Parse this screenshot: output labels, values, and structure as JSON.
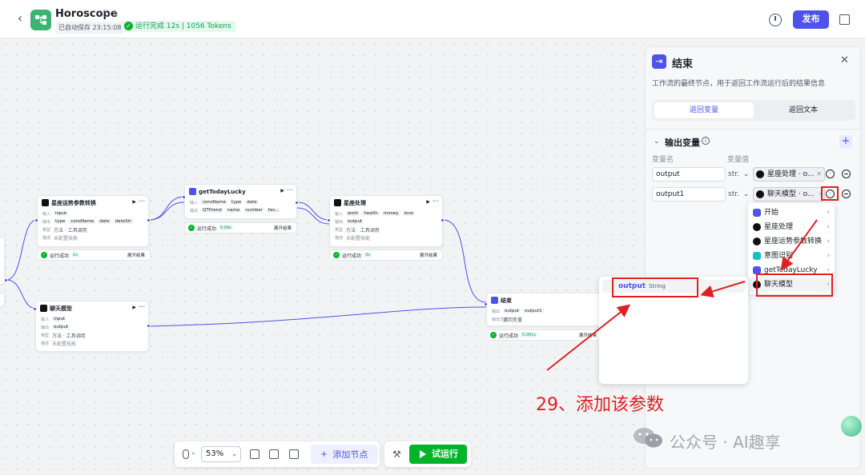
{
  "header": {
    "title": "Horoscope",
    "autosave": "已自动保存 23:15:08",
    "run_status": "运行完成 12s | 1056 Tokens",
    "publish": "发布"
  },
  "canvas": {
    "nodes": {
      "zodiac_convert": {
        "title": "星座运势参数转换",
        "input_label": "输入",
        "input": "input",
        "output_label": "输出",
        "outputs": [
          "type",
          "consName",
          "date",
          "dateStr"
        ],
        "type_label": "类型",
        "type_value": "方法 · 工具调用",
        "desc_label": "描述",
        "desc_value": "未配置技能",
        "status": "运行成功",
        "time": "1s",
        "expand": "展开结果"
      },
      "get_today_lucky": {
        "title": "getTodayLucky",
        "input_label": "输入",
        "inputs": [
          "consName",
          "type",
          "date"
        ],
        "output_label": "输出",
        "outputs": [
          "QTfriend",
          "name",
          "number",
          "fav..."
        ],
        "status": "运行成功",
        "time": "0.99s",
        "expand": "展开结果"
      },
      "zodiac_process": {
        "title": "星座处理",
        "input_label": "输入",
        "inputs": [
          "work",
          "health",
          "money",
          "love"
        ],
        "output_label": "输出",
        "outputs": [
          "output"
        ],
        "type_label": "类型",
        "type_value": "方法 · 工具调用",
        "desc_label": "描述",
        "desc_value": "未配置技能",
        "status": "运行成功",
        "time": "3s",
        "expand": "展开结果"
      },
      "chat_model": {
        "title": "聊天模型",
        "input_label": "输入",
        "input": "input",
        "output_label": "输出",
        "output": "output",
        "type_label": "类型",
        "type_value": "方法 · 工具调用",
        "desc_label": "描述",
        "desc_value": "未配置技能"
      },
      "end": {
        "title": "结束",
        "output_label": "输出",
        "outputs": [
          "output",
          "output1"
        ],
        "mode_label": "输出方式",
        "mode": "返回变量",
        "status": "运行成功",
        "time": "0.001s",
        "expand": "展开结果"
      }
    }
  },
  "toolbar": {
    "zoom": "53%",
    "add_node": "添加节点",
    "try_run": "试运行"
  },
  "panel": {
    "title": "结束",
    "description": "工作流的最终节点，用于返回工作流运行后的结果信息",
    "tabs": [
      "返回变量",
      "返回文本"
    ],
    "section_title": "输出变量",
    "col_name": "变量名",
    "col_value": "变量值",
    "rows": [
      {
        "name": "output",
        "type": "str.",
        "value": "星座处理 · o..."
      },
      {
        "name": "output1",
        "type": "str.",
        "value": "聊天模型 · o..."
      }
    ]
  },
  "menu": {
    "items": [
      "开始",
      "星座处理",
      "星座运势参数转换",
      "意图识别",
      "getTodayLucky",
      "聊天模型"
    ],
    "icon_colors": [
      "#4d53e8",
      "#111111",
      "#111111",
      "#13c2c2",
      "#4d53e8",
      "#111111"
    ]
  },
  "submenu": {
    "name": "output",
    "type": "String"
  },
  "annotation": {
    "note": "29、添加该参数",
    "watermark": "公众号 · AI趣享"
  },
  "colors": {
    "accent": "#4d53e8",
    "success": "#00b42a",
    "annotation": "#e02020"
  }
}
